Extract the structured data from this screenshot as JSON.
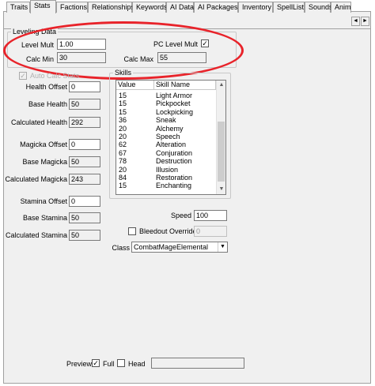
{
  "tabs": [
    {
      "label": "Traits"
    },
    {
      "label": "Stats"
    },
    {
      "label": "Factions"
    },
    {
      "label": "Relationships"
    },
    {
      "label": "Keywords"
    },
    {
      "label": "AI Data"
    },
    {
      "label": "AI Packages"
    },
    {
      "label": "Inventory"
    },
    {
      "label": "SpellList"
    },
    {
      "label": "Sounds"
    },
    {
      "label": "Anim"
    }
  ],
  "active_tab": "Stats",
  "tab_scroll": {
    "left": "◄",
    "right": "►"
  },
  "leveling": {
    "group_title": "Leveling Data",
    "level_mult_label": "Level Mult",
    "level_mult_value": "1.00",
    "pc_level_mult_label": "PC Level Mult",
    "pc_level_mult_checked": "✓",
    "calc_min_label": "Calc Min",
    "calc_min_value": "30",
    "calc_max_label": "Calc Max",
    "calc_max_value": "55"
  },
  "auto_calc": {
    "label": "Auto Calc Stats",
    "checked": "✓"
  },
  "health": {
    "offset_label": "Health Offset",
    "offset_value": "0",
    "base_label": "Base Health",
    "base_value": "50",
    "calc_label": "Calculated Health",
    "calc_value": "292"
  },
  "magicka": {
    "offset_label": "Magicka Offset",
    "offset_value": "0",
    "base_label": "Base Magicka",
    "base_value": "50",
    "calc_label": "Calculated Magicka",
    "calc_value": "243"
  },
  "stamina": {
    "offset_label": "Stamina Offset",
    "offset_value": "0",
    "base_label": "Base Stamina",
    "base_value": "50",
    "calc_label": "Calculated Stamina",
    "calc_value": "50"
  },
  "skills": {
    "group_title": "Skills",
    "col_value": "Value",
    "col_name": "Skill Name",
    "rows": [
      {
        "value": "15",
        "name": "Light Armor"
      },
      {
        "value": "15",
        "name": "Pickpocket"
      },
      {
        "value": "15",
        "name": "Lockpicking"
      },
      {
        "value": "36",
        "name": "Sneak"
      },
      {
        "value": "20",
        "name": "Alchemy"
      },
      {
        "value": "20",
        "name": "Speech"
      },
      {
        "value": "62",
        "name": "Alteration"
      },
      {
        "value": "67",
        "name": "Conjuration"
      },
      {
        "value": "78",
        "name": "Destruction"
      },
      {
        "value": "20",
        "name": "Illusion"
      },
      {
        "value": "84",
        "name": "Restoration"
      },
      {
        "value": "15",
        "name": "Enchanting"
      }
    ],
    "scroll_up": "▲",
    "scroll_down": "▼"
  },
  "speed": {
    "label": "Speed",
    "value": "100"
  },
  "bleedout": {
    "label": "Bleedout Override",
    "value": "0"
  },
  "class": {
    "label": "Class",
    "value": "CombatMageElemental",
    "arrow": "▼"
  },
  "preview": {
    "label": "Preview",
    "full_label": "Full",
    "full_checked": "✓",
    "head_label": "Head"
  }
}
